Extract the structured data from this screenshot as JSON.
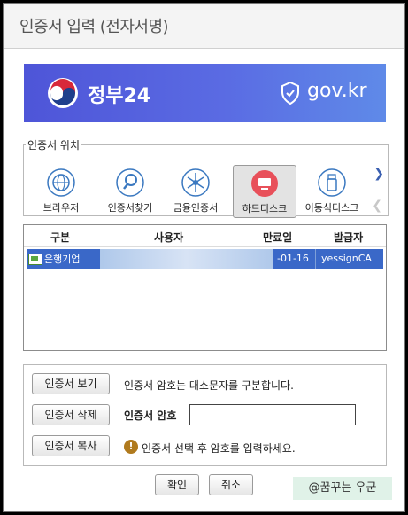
{
  "window": {
    "title": "인증서 입력 (전자서명)"
  },
  "banner": {
    "gov_name": "정부24",
    "domain": "gov.kr"
  },
  "location": {
    "legend": "인증서 위치",
    "items": [
      {
        "label": "브라우저",
        "icon": "globe-icon"
      },
      {
        "label": "인증서찾기",
        "icon": "magnifier-icon"
      },
      {
        "label": "금융인증서",
        "icon": "network-icon"
      },
      {
        "label": "하드디스크",
        "icon": "monitor-icon",
        "selected": true
      },
      {
        "label": "이동식디스크",
        "icon": "usb-icon"
      }
    ]
  },
  "cert_table": {
    "headers": {
      "type": "구분",
      "user": "사용자",
      "expiry": "만료일",
      "issuer": "발급자"
    },
    "rows": [
      {
        "type": "은행기업",
        "user": "",
        "expiry": "-01-16",
        "issuer": "yessignCA ..."
      }
    ]
  },
  "buttons": {
    "view": "인증서 보기",
    "delete": "인증서 삭제",
    "copy": "인증서 복사",
    "ok": "확인",
    "cancel": "취소"
  },
  "messages": {
    "case_notice": "인증서 암호는 대소문자를 구분합니다.",
    "password_label": "인증서 암호",
    "password_value": "",
    "warning": "인증서 선택 후 암호를 입력하세요."
  },
  "watermark": "@꿈꾸는 우군",
  "colors": {
    "banner": "#5566de",
    "selected_row": "#3a68c8",
    "emblem_red": "#d8283a",
    "emblem_blue": "#1f3f8c"
  }
}
